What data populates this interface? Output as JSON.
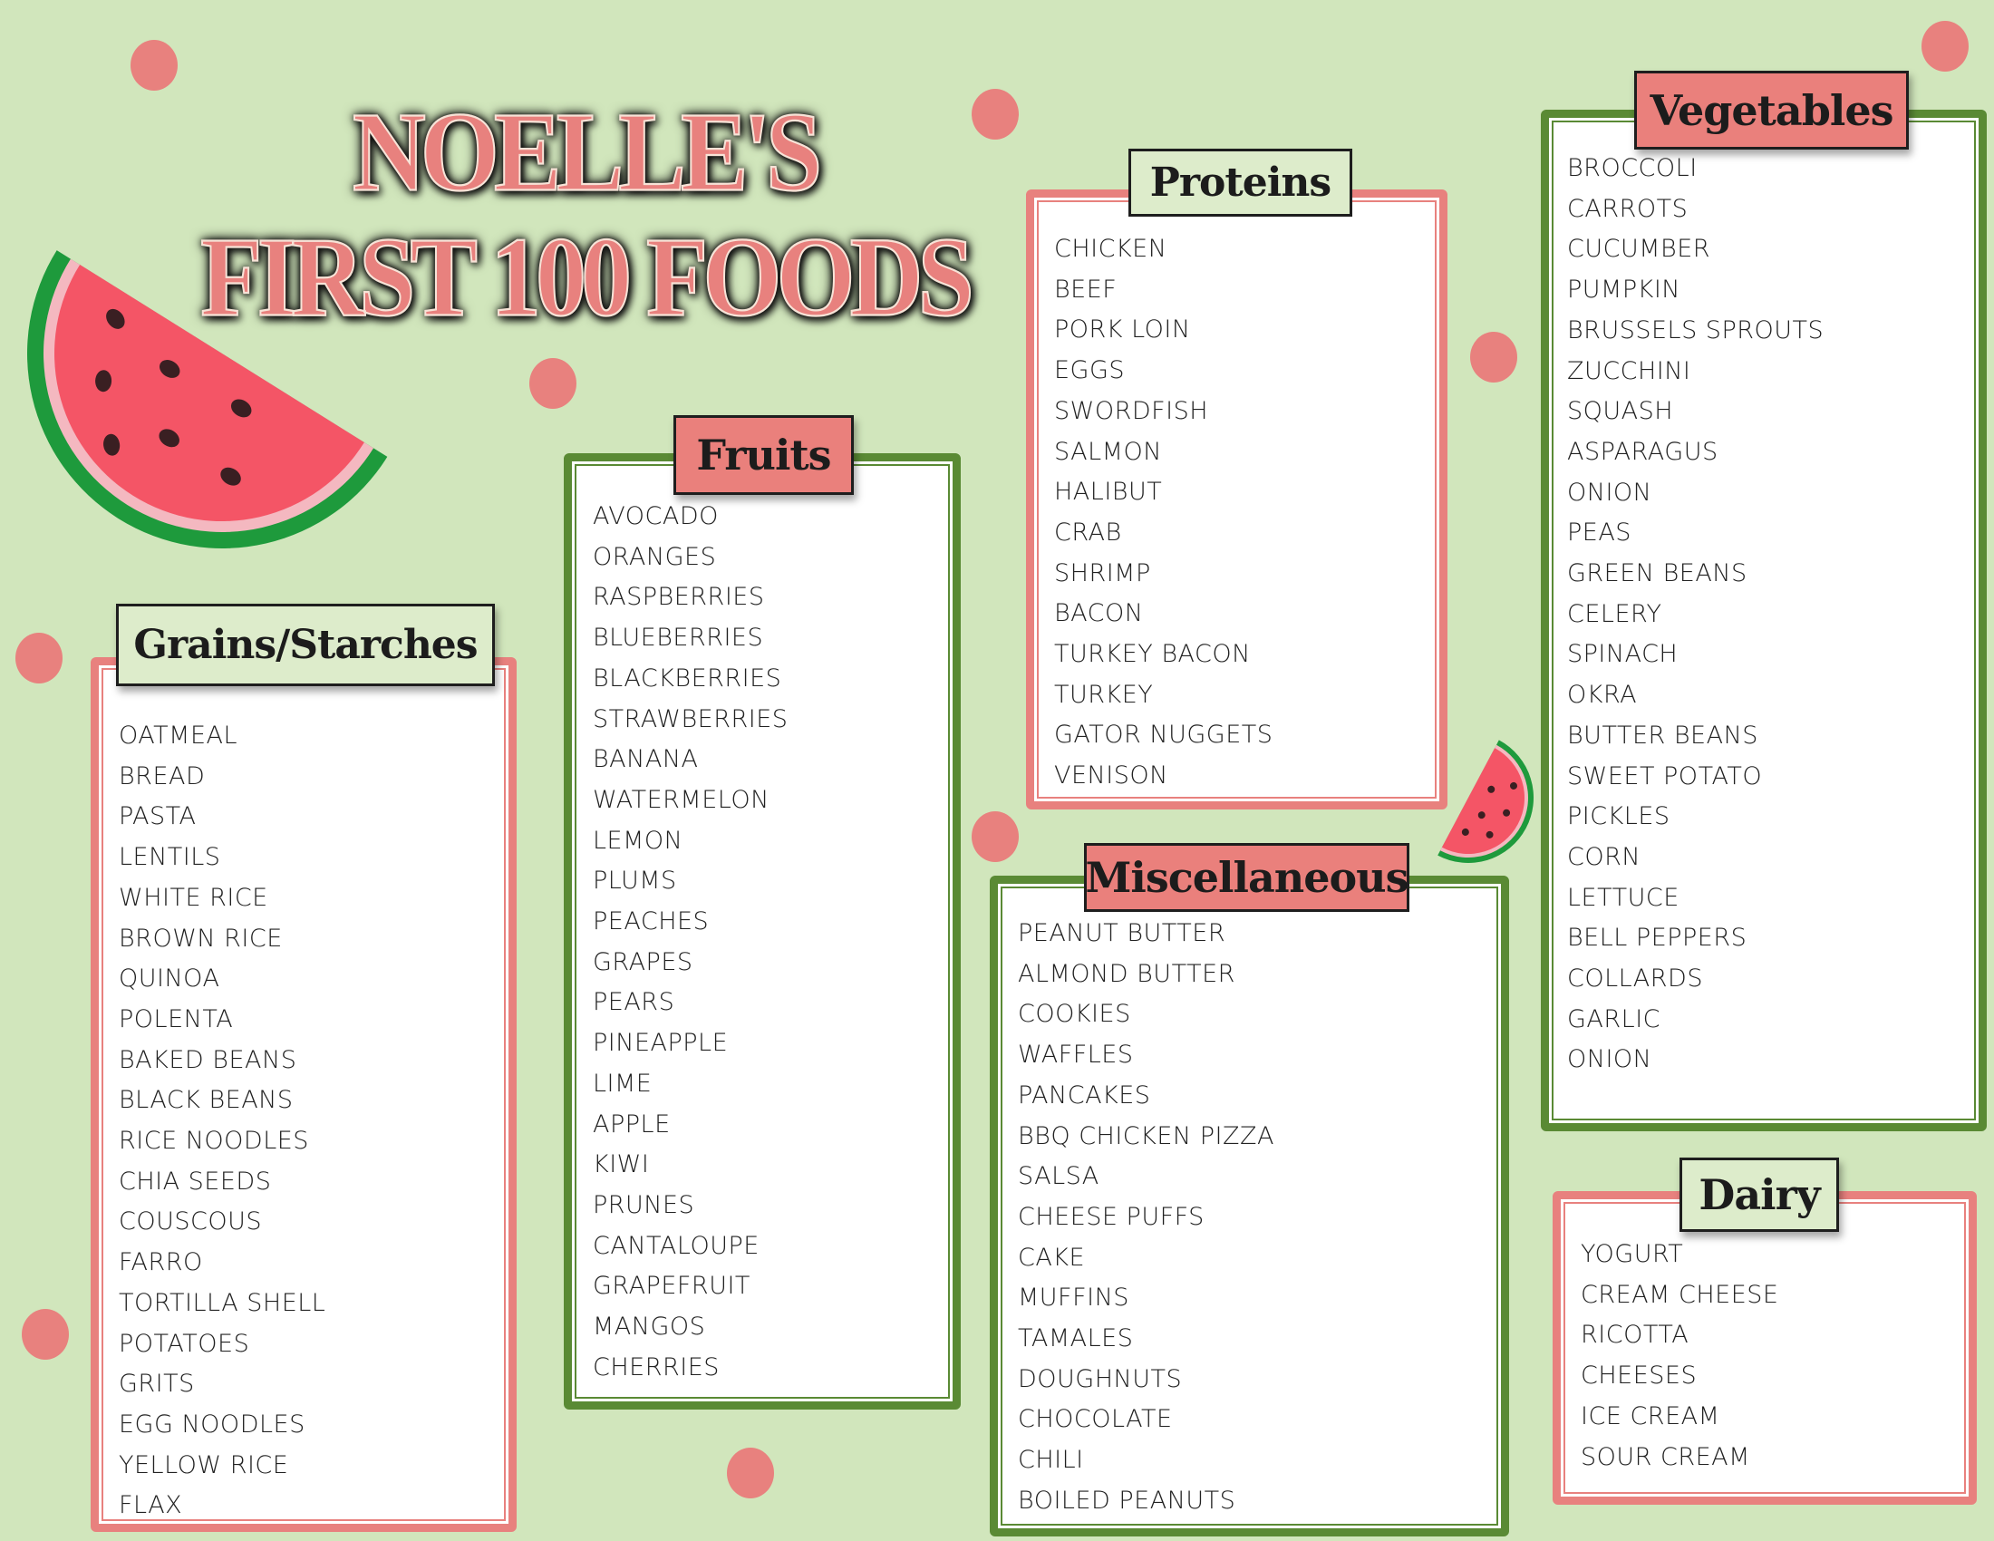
{
  "title": {
    "line1": "NOELLE'S",
    "line2": "FIRST 100 FOODS"
  },
  "colors": {
    "background": "#d1e6bc",
    "salmon": "#e8817e",
    "green_border": "#5a8a34",
    "header_green": "#ddeccb"
  },
  "icons": {
    "large": "watermelon-slice-icon",
    "small": "watermelon-slice-icon",
    "dots": "polka-dot"
  },
  "categories": {
    "grains": {
      "title": "Grains/Starches",
      "items": [
        "OATMEAL",
        "BREAD",
        "PASTA",
        "LENTILS",
        "WHITE RICE",
        "BROWN RICE",
        "QUINOA",
        "POLENTA",
        "BAKED BEANS",
        "BLACK BEANS",
        "RICE NOODLES",
        "CHIA SEEDS",
        "COUSCOUS",
        "FARRO",
        "TORTILLA SHELL",
        "POTATOES",
        "GRITS",
        "EGG NOODLES",
        "YELLOW RICE",
        "FLAX"
      ]
    },
    "fruits": {
      "title": "Fruits",
      "items": [
        "AVOCADO",
        "ORANGES",
        "RASPBERRIES",
        "BLUEBERRIES",
        "BLACKBERRIES",
        "STRAWBERRIES",
        "BANANA",
        "WATERMELON",
        "LEMON",
        "PLUMS",
        "PEACHES",
        "GRAPES",
        "PEARS",
        "PINEAPPLE",
        "LIME",
        "APPLE",
        "KIWI",
        "PRUNES",
        "CANTALOUPE",
        "GRAPEFRUIT",
        "MANGOS",
        "CHERRIES"
      ]
    },
    "proteins": {
      "title": "Proteins",
      "items": [
        "CHICKEN",
        "BEEF",
        "PORK LOIN",
        "EGGS",
        "SWORDFISH",
        "SALMON",
        "HALIBUT",
        "CRAB",
        "SHRIMP",
        "BACON",
        "TURKEY BACON",
        "TURKEY",
        "GATOR NUGGETS",
        "VENISON"
      ]
    },
    "misc": {
      "title": "Miscellaneous",
      "items": [
        "PEANUT BUTTER",
        "ALMOND BUTTER",
        "COOKIES",
        "WAFFLES",
        "PANCAKES",
        "BBQ CHICKEN PIZZA",
        "SALSA",
        "CHEESE PUFFS",
        "CAKE",
        "MUFFINS",
        "TAMALES",
        "DOUGHNUTS",
        "CHOCOLATE",
        "CHILI",
        "BOILED PEANUTS"
      ]
    },
    "vegetables": {
      "title": "Vegetables",
      "items": [
        "BROCCOLI",
        "CARROTS",
        "CUCUMBER",
        "PUMPKIN",
        "BRUSSELS SPROUTS",
        "ZUCCHINI",
        "SQUASH",
        "ASPARAGUS",
        "ONION",
        "PEAS",
        "GREEN BEANS",
        "CELERY",
        "SPINACH",
        "OKRA",
        "BUTTER BEANS",
        "SWEET POTATO",
        "PICKLES",
        "CORN",
        "LETTUCE",
        "BELL PEPPERS",
        "COLLARDS",
        "GARLIC",
        "ONION"
      ]
    },
    "dairy": {
      "title": "Dairy",
      "items": [
        "YOGURT",
        "CREAM CHEESE",
        "RICOTTA",
        "CHEESES",
        "ICE CREAM",
        "SOUR CREAM"
      ]
    }
  }
}
